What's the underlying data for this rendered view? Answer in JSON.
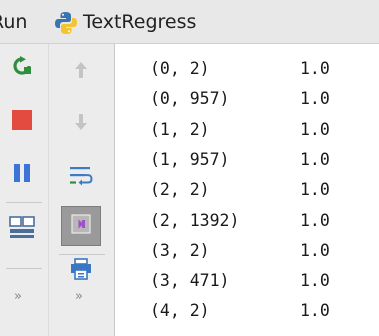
{
  "header": {
    "run_label": "Run",
    "config_name": "TextRegress",
    "config_icon": "python-icon"
  },
  "toolbar_left": [
    {
      "name": "rerun",
      "icon": "rerun-icon",
      "color": "#2e8b3a"
    },
    {
      "name": "stop",
      "icon": "stop-icon",
      "color": "#e0443e"
    },
    {
      "name": "pause",
      "icon": "pause-icon",
      "color": "#3b6fd0"
    },
    {
      "name": "restore-layout",
      "icon": "layout-icon",
      "color": "#4a6fa5"
    },
    {
      "name": "more",
      "icon": "chevron-double-right-icon",
      "label": "»"
    }
  ],
  "toolbar_right": [
    {
      "name": "up-stack",
      "icon": "arrow-up-icon",
      "disabled": true
    },
    {
      "name": "down-stack",
      "icon": "arrow-down-icon",
      "disabled": true
    },
    {
      "name": "soft-wrap",
      "icon": "soft-wrap-icon"
    },
    {
      "name": "scroll-to-end",
      "icon": "scroll-to-end-icon",
      "active": true
    },
    {
      "name": "print",
      "icon": "print-icon"
    },
    {
      "name": "more",
      "icon": "chevron-double-right-icon",
      "label": "»"
    }
  ],
  "output": {
    "lines": [
      {
        "key": "(0, 2)",
        "value": "1.0"
      },
      {
        "key": "(0, 957)",
        "value": "1.0"
      },
      {
        "key": "(1, 2)",
        "value": "1.0"
      },
      {
        "key": "(1, 957)",
        "value": "1.0"
      },
      {
        "key": "(2, 2)",
        "value": "1.0"
      },
      {
        "key": "(2, 1392)",
        "value": "1.0"
      },
      {
        "key": "(3, 2)",
        "value": "1.0"
      },
      {
        "key": "(3, 471)",
        "value": "1.0"
      },
      {
        "key": "(4, 2)",
        "value": "1.0"
      }
    ]
  }
}
